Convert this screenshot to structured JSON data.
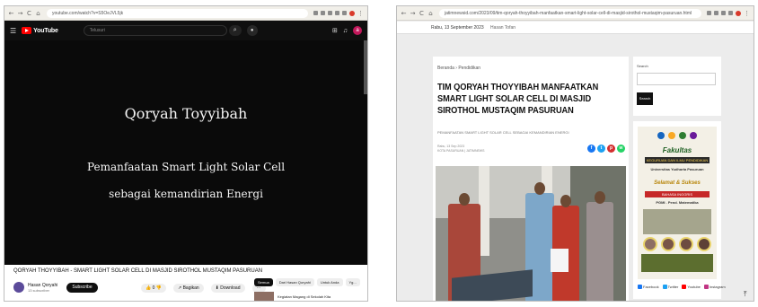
{
  "left": {
    "browser": {
      "url": "youtube.com/watch?v=S5OeJVL5jk",
      "nav": [
        "←",
        "→",
        "C",
        "⌂"
      ]
    },
    "youtube": {
      "logo_text": "YouTube",
      "search_placeholder": "Telusuri",
      "avatar_letter": "a",
      "video_text": {
        "line1": "Qoryah Toyyibah",
        "line2": "Pemanfaatan Smart Light Solar Cell",
        "line3": "sebagai kemandirian Energi"
      },
      "video_title": "QORYAH THOYYIBAH - SMART LIGHT SOLAR CELL DI MASJID SIROTHOL MUSTAQIM PASURUAN",
      "channel_name": "Hasan Qoryahi",
      "channel_subs": "13 subscriber",
      "subscribe_label": "Subscribe",
      "actions": [
        "👍 0  👎",
        "↗ Bagikan",
        "⬇ Download",
        "⋯"
      ],
      "chips": [
        "Semua",
        "Dari Hasan Qoryahi",
        "Untuk Anda",
        "Yg..."
      ],
      "recommended_title": "Kegiatan Magang di Sekolah Kita"
    }
  },
  "right": {
    "browser": {
      "url": "jatimnewsid.com/2023/09/tim-qoryah-thoyyibah-manfaatkan-smart-light-solar-cell-di-masjid-sirothol-mustaqim-pasuruan.html",
      "nav": [
        "←",
        "→",
        "C",
        "⌂"
      ]
    },
    "blog": {
      "date_line": "Rabu, 13 September 2023",
      "date_tag": "Hasan Tofan",
      "breadcrumb": "Beranda  ›  Pendidikan",
      "title": "TIM QORYAH THOYYIBAH MANFAATKAN SMART LIGHT SOLAR CELL DI MASJID SIROTHOL MUSTAQIM PASURUAN",
      "subtitle": "PEMANFAATAN SMART LIGHT SOLAR CELL SEBAGAI KEMANDIRIAN ENERGI",
      "meta_line1": "Rabu, 13 Sep 2023",
      "meta_line2": "KOTA PASURUAN | JATIMNEWS",
      "share_colors": [
        "#1877f2",
        "#1da1f2",
        "#ff0000",
        "#25d366"
      ],
      "sidebar_search_label": "Search",
      "sidebar_search_button": "Search",
      "poster": {
        "title": "Fakultas",
        "line2": "KEGURUAN DAN ILMU PENDIDIKAN",
        "line3": "Universitas Yudharta Pasuruan",
        "line4": "Selamat & Sukses",
        "line5": "BAHASA INGGRIS",
        "line6": "PGMI . Pend. Matematika"
      },
      "social_labels": [
        "Facebook",
        "Twitter",
        "Youtube",
        "Instagram"
      ]
    }
  }
}
